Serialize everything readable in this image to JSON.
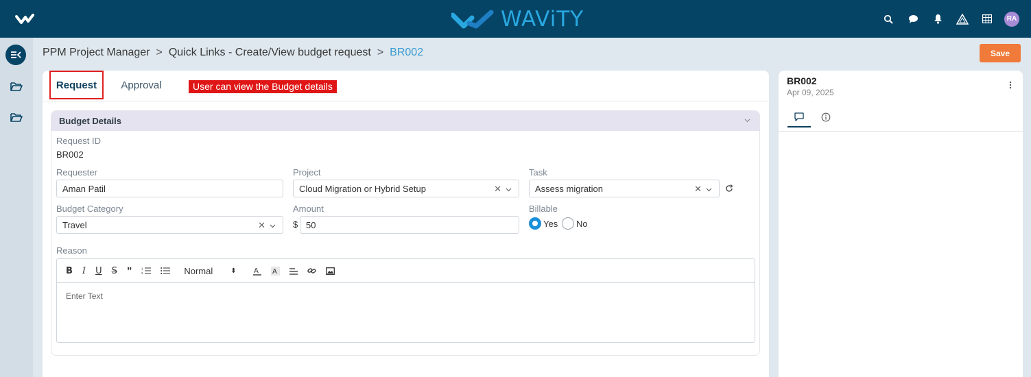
{
  "app": {
    "logo_text": "WAViTY",
    "avatar_initials": "RA",
    "colors": {
      "topbar": "#064466",
      "accent": "#29a8e0",
      "save": "#f07a3a",
      "annotation": "#e01616"
    }
  },
  "topbar": {
    "icons": [
      "search-icon",
      "chat-icon",
      "bell-icon",
      "warning-triangle-icon",
      "grid-icon"
    ]
  },
  "breadcrumb": {
    "items": [
      "PPM Project Manager",
      "Quick Links - Create/View budget request"
    ],
    "separator": ">",
    "current": "BR002"
  },
  "actions": {
    "save_label": "Save"
  },
  "tabs": {
    "request": "Request",
    "approval": "Approval",
    "annotation": "User can view the Budget details"
  },
  "section": {
    "title": "Budget Details",
    "request_id_label": "Request ID",
    "request_id": "BR002",
    "requester_label": "Requester",
    "requester": "Aman Patil",
    "project_label": "Project",
    "project": "Cloud Migration or Hybrid Setup",
    "task_label": "Task",
    "task": "Assess migration",
    "budget_category_label": "Budget Category",
    "budget_category": "Travel",
    "amount_label": "Amount",
    "currency_symbol": "$",
    "amount": "50",
    "billable_label": "Billable",
    "billable_options": [
      "Yes",
      "No"
    ],
    "billable_selected": "Yes",
    "reason_label": "Reason"
  },
  "editor": {
    "heading_select": "Normal",
    "placeholder": "Enter Text"
  },
  "side_panel": {
    "id": "BR002",
    "date": "Apr 09, 2025"
  }
}
